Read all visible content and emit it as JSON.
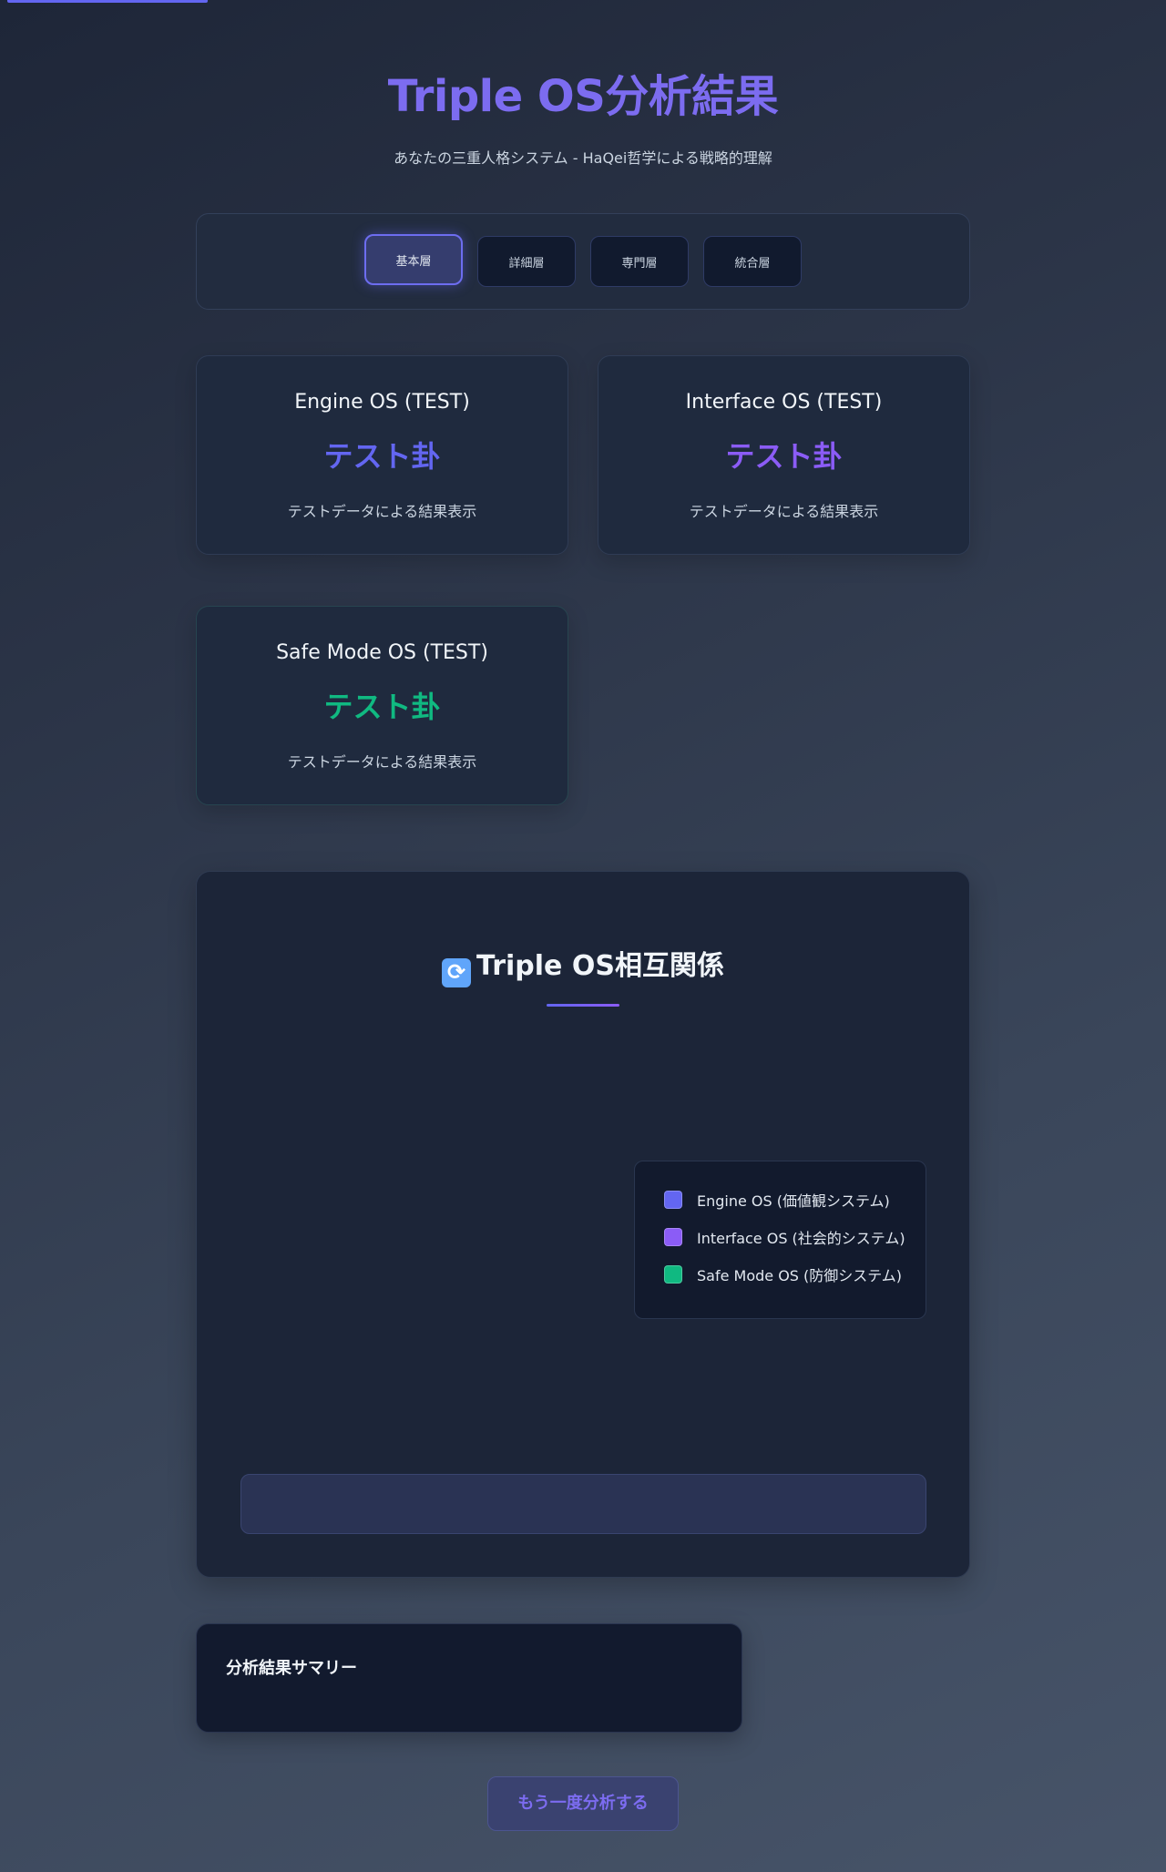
{
  "header": {
    "title": "Triple OS分析結果",
    "subtitle": "あなたの三重人格システム - HaQei哲学による戦略的理解"
  },
  "tabs": [
    {
      "label": "基本層",
      "active": true
    },
    {
      "label": "詳細層",
      "active": false
    },
    {
      "label": "専門層",
      "active": false
    },
    {
      "label": "統合層",
      "active": false
    }
  ],
  "cards": {
    "engine": {
      "title": "Engine OS (TEST)",
      "hexagram": "テスト卦",
      "description": "テストデータによる結果表示",
      "color": "#6366f1"
    },
    "interface": {
      "title": "Interface OS (TEST)",
      "hexagram": "テスト卦",
      "description": "テストデータによる結果表示",
      "color": "#8b5cf6"
    },
    "safe": {
      "title": "Safe Mode OS (TEST)",
      "hexagram": "テスト卦",
      "description": "テストデータによる結果表示",
      "color": "#10b981"
    }
  },
  "relations": {
    "icon": "refresh-icon",
    "title": "Triple OS相互関係",
    "legend": [
      {
        "label": "Engine OS (価値観システム)",
        "color": "#6366f1"
      },
      {
        "label": "Interface OS (社会的システム)",
        "color": "#8b5cf6"
      },
      {
        "label": "Safe Mode OS (防御システム)",
        "color": "#10b981"
      }
    ]
  },
  "summary": {
    "title": "分析結果サマリー"
  },
  "actions": {
    "retry_label": "もう一度分析する"
  }
}
